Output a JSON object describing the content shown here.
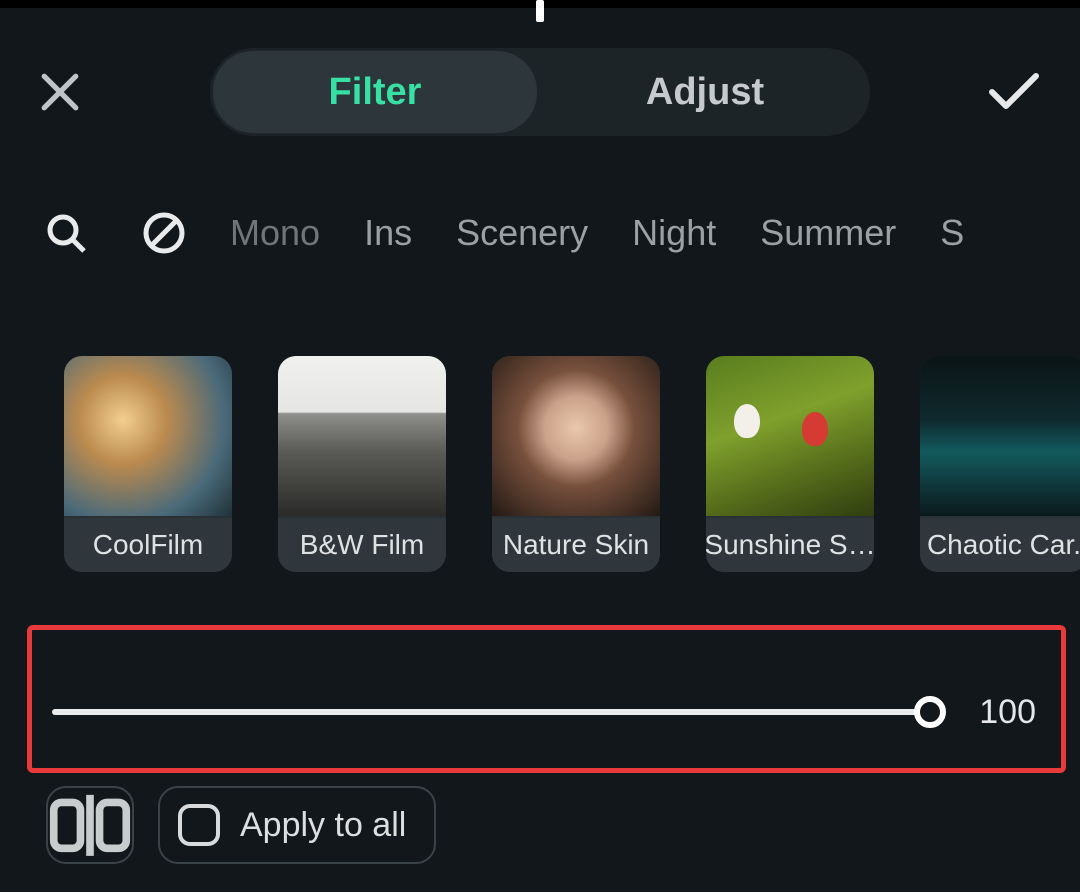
{
  "header": {
    "tabs": {
      "filter": "Filter",
      "adjust": "Adjust"
    }
  },
  "categories": {
    "items": [
      "Mono",
      "Ins",
      "Scenery",
      "Night",
      "Summer",
      "S"
    ]
  },
  "filters": {
    "items": [
      {
        "label": "CoolFilm"
      },
      {
        "label": "B&W Film"
      },
      {
        "label": "Nature Skin"
      },
      {
        "label": "Sunshine S…"
      },
      {
        "label": "Chaotic Car."
      }
    ]
  },
  "slider": {
    "value": "100"
  },
  "bottom": {
    "apply_all_label": "Apply to all"
  }
}
